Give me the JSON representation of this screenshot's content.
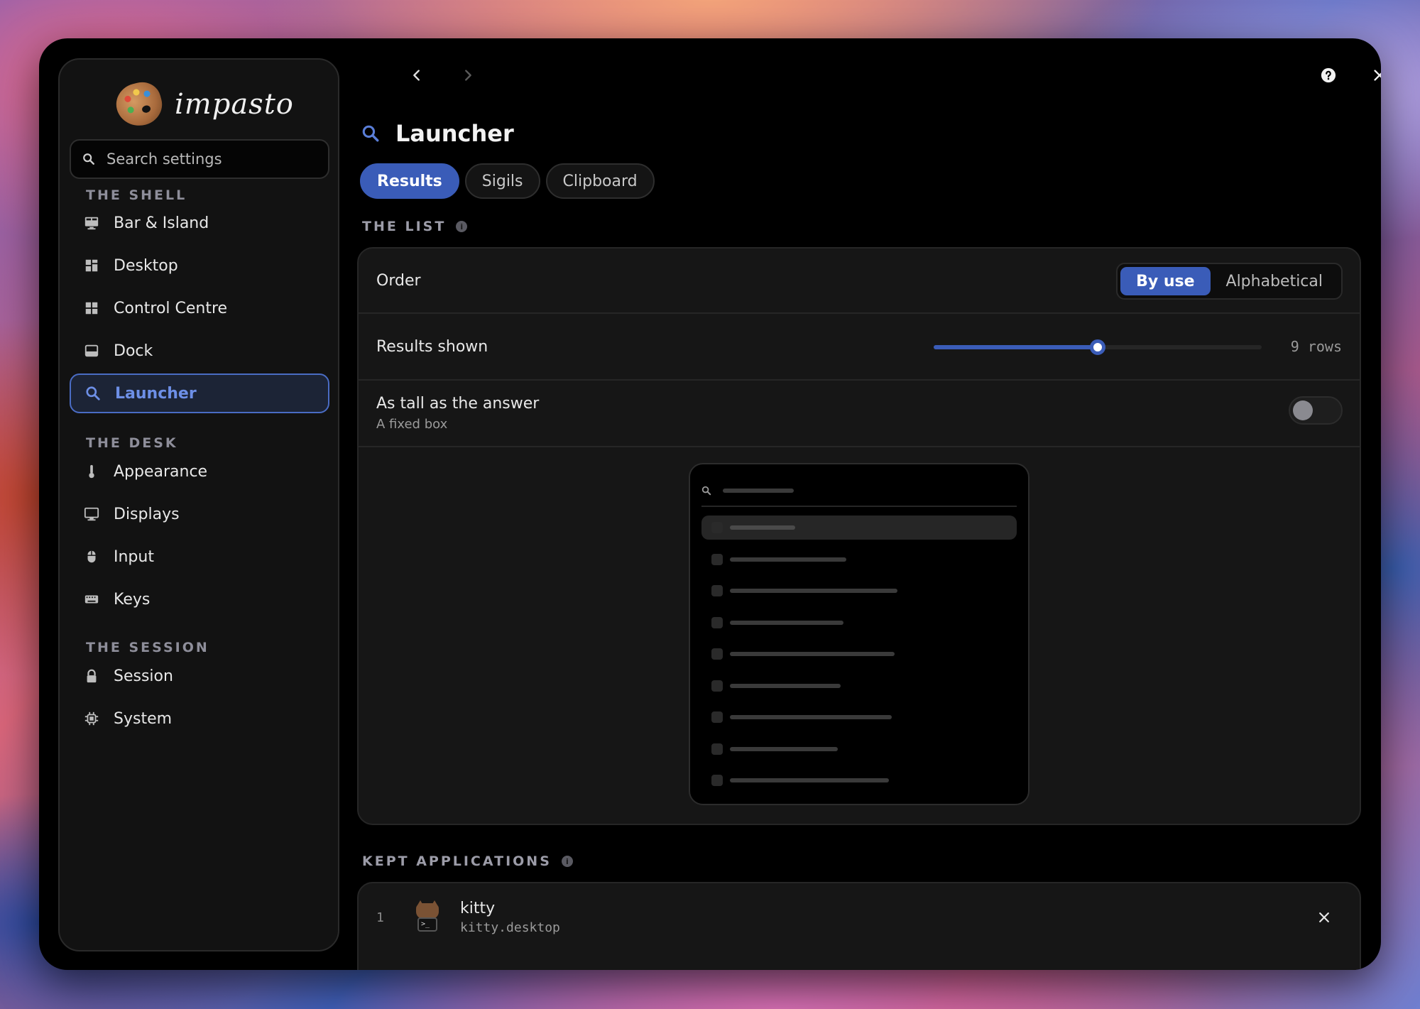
{
  "brand": {
    "name": "impasto"
  },
  "search": {
    "placeholder": "Search settings"
  },
  "sidebar": {
    "sections": [
      {
        "label": "THE SHELL"
      },
      {
        "label": "THE DESK"
      },
      {
        "label": "THE SESSION"
      }
    ],
    "items": [
      {
        "label": "Bar & Island",
        "icon": "monitor-bar-icon"
      },
      {
        "label": "Desktop",
        "icon": "grid-icon"
      },
      {
        "label": "Control Centre",
        "icon": "grid-icon"
      },
      {
        "label": "Dock",
        "icon": "dock-icon"
      },
      {
        "label": "Launcher",
        "icon": "search-icon",
        "active": true
      },
      {
        "label": "Appearance",
        "icon": "thermometer-icon"
      },
      {
        "label": "Displays",
        "icon": "monitor-icon"
      },
      {
        "label": "Input",
        "icon": "mouse-icon"
      },
      {
        "label": "Keys",
        "icon": "keyboard-icon"
      },
      {
        "label": "Session",
        "icon": "lock-icon"
      },
      {
        "label": "System",
        "icon": "chip-icon"
      }
    ]
  },
  "page": {
    "title": "Launcher"
  },
  "tabs": [
    {
      "label": "Results",
      "active": true
    },
    {
      "label": "Sigils"
    },
    {
      "label": "Clipboard"
    }
  ],
  "the_list": {
    "heading": "THE LIST",
    "order": {
      "label": "Order",
      "options": [
        "By use",
        "Alphabetical"
      ],
      "selected": "By use"
    },
    "results_shown": {
      "label": "Results shown",
      "value_text": "9 rows",
      "fraction": 0.5
    },
    "tall": {
      "label": "As tall as the answer",
      "sublabel": "A fixed box",
      "enabled": false
    }
  },
  "kept": {
    "heading": "KEPT APPLICATIONS",
    "items": [
      {
        "index": "1",
        "name": "kitty",
        "file": "kitty.desktop"
      }
    ]
  },
  "colors": {
    "accent": "#3a5cb8",
    "accent_text": "#6d8fe6",
    "window_bg": "#000000",
    "card_bg": "#161616"
  }
}
